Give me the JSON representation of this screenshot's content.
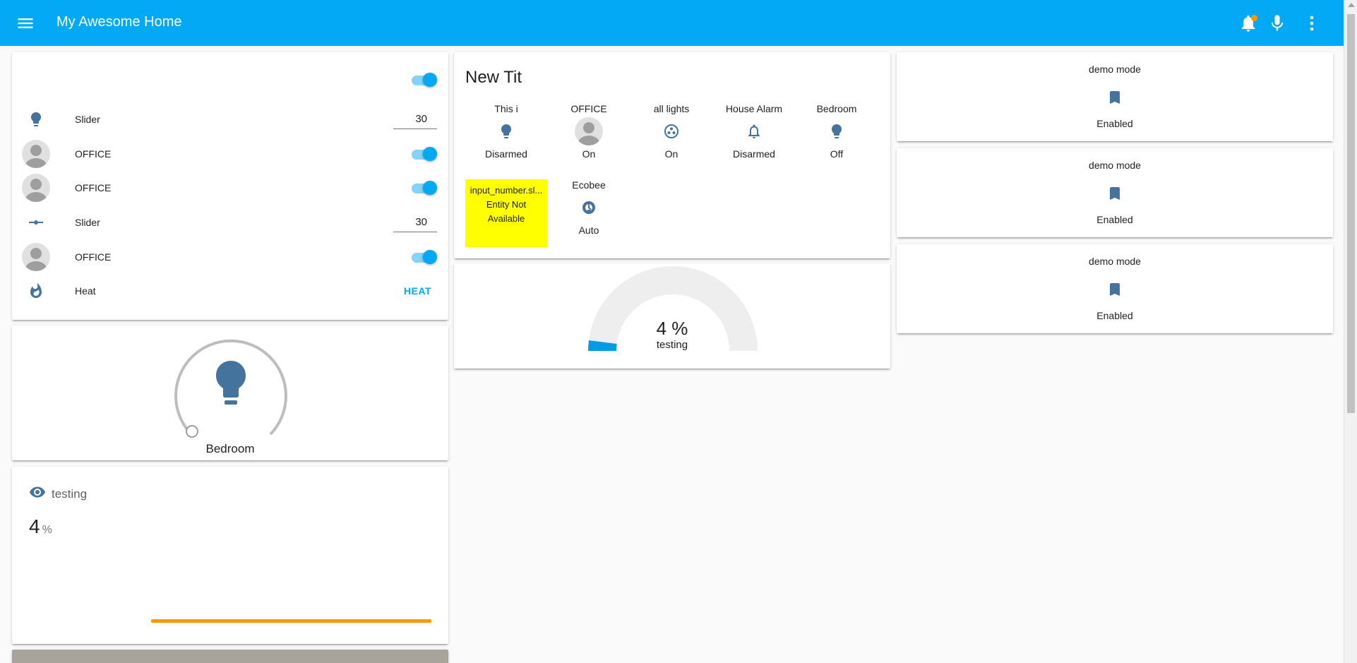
{
  "app": {
    "title": "My Awesome Home",
    "accent": "#03a9f4",
    "icon_color": "#44739e"
  },
  "toolbar": {
    "menu_icon": "menu-icon",
    "icons": [
      "bell-icon",
      "microphone-icon",
      "more-vertical-icon"
    ]
  },
  "entities_card": {
    "header_toggle": true,
    "rows": [
      {
        "icon": "lightbulb-icon",
        "name": "Slider",
        "value": "30"
      },
      {
        "icon": "avatar",
        "name": "OFFICE",
        "toggle": true
      },
      {
        "icon": "avatar",
        "name": "OFFICE",
        "toggle": true
      },
      {
        "icon": "ray-vertex-icon",
        "name": "Slider",
        "value": "30"
      },
      {
        "icon": "avatar",
        "name": "OFFICE",
        "toggle": true
      },
      {
        "icon": "fire-icon",
        "name": "Heat",
        "action": "HEAT"
      }
    ]
  },
  "light_card": {
    "name": "Bedroom",
    "icon": "lightbulb-icon"
  },
  "sensor_card": {
    "name": "testing",
    "icon": "eye-icon",
    "value": "4",
    "unit": "%",
    "line_color": "#ff9800"
  },
  "glance_card": {
    "title": "New Tit",
    "items": [
      {
        "name": "This i",
        "icon": "lightbulb-icon",
        "state": "Disarmed"
      },
      {
        "name": "OFFICE",
        "icon": "avatar",
        "state": "On"
      },
      {
        "name": "all lights",
        "icon": "lightbulb-group-icon",
        "state": "On"
      },
      {
        "name": "House Alarm",
        "icon": "bell-icon",
        "state": "Disarmed"
      },
      {
        "name": "Bedroom",
        "icon": "lightbulb-icon",
        "state": "Off"
      },
      {
        "name": "Ecobee",
        "icon": "thermostat-icon",
        "state": "Auto"
      }
    ],
    "warning": {
      "entity": "input_number.sl...",
      "line1": "Entity Not",
      "line2": "Available",
      "color": "#ffff00"
    }
  },
  "gauge_card": {
    "value": "4 %",
    "name": "testing",
    "percent": 4,
    "fill_color": "#039be5"
  },
  "demo_cards": [
    {
      "name": "demo mode",
      "icon": "bookmark-icon",
      "state": "Enabled"
    },
    {
      "name": "demo mode",
      "icon": "bookmark-icon",
      "state": "Enabled"
    },
    {
      "name": "demo mode",
      "icon": "bookmark-icon",
      "state": "Enabled"
    }
  ]
}
